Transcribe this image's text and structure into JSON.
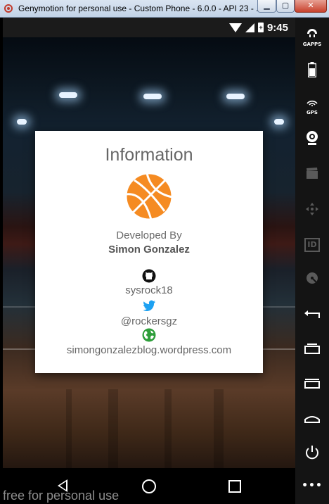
{
  "window": {
    "title": "Genymotion for personal use - Custom Phone - 6.0.0 - API 23 - ...",
    "minimize_glyph": "▁",
    "maximize_glyph": "▢",
    "close_glyph": "✕"
  },
  "statusbar": {
    "time": "9:45"
  },
  "dialog": {
    "title": "Information",
    "developed_by_label": "Developed By",
    "developer_name": "Simon Gonzalez",
    "github_handle": "sysrock18",
    "twitter_handle": "@rockersgz",
    "website": "simongonzalezblog.wordpress.com",
    "accent": "#f58b22"
  },
  "sidebar": {
    "gapps_label": "GAPPS",
    "gps_label": "GPS",
    "id_label": "ID",
    "menu_glyph": "•••"
  },
  "watermark": "free for personal use"
}
